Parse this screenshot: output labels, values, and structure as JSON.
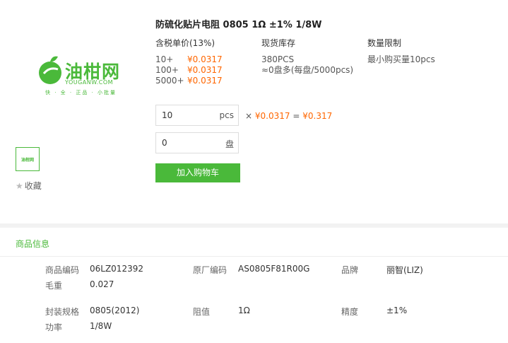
{
  "logo": {
    "brand": "油柑网",
    "domain": "YOUGANW.COM",
    "slogan": "快 · 全 · 正品 · 小批量",
    "thumb_text": "油柑网"
  },
  "favorite_label": "收藏",
  "product": {
    "title": "防硫化贴片电阻 0805 1Ω ±1% 1/8W"
  },
  "price_col": {
    "header": "含税单价(13%)",
    "tiers": [
      {
        "qty": "10+",
        "price": "¥0.0317"
      },
      {
        "qty": "100+",
        "price": "¥0.0317"
      },
      {
        "qty": "5000+",
        "price": "¥0.0317"
      }
    ]
  },
  "stock_col": {
    "header": "现货库存",
    "lines": [
      "380PCS",
      "≈0盘多(每盘/5000pcs)"
    ]
  },
  "limit_col": {
    "header": "数量限制",
    "lines": [
      "最小购买量10pcs"
    ]
  },
  "order": {
    "pcs_value": "10",
    "pcs_unit": "pcs",
    "reel_value": "0",
    "reel_unit": "盘",
    "times": "×",
    "unit_price": "¥0.0317",
    "equals": "=",
    "total": "¥0.317",
    "cart_button": "加入购物车"
  },
  "info": {
    "title": "商品信息",
    "rows": [
      {
        "l1": "商品编码",
        "v1": "06LZ012392",
        "l2": "原厂编码",
        "v2": "AS0805F81R00G",
        "l3": "品牌",
        "v3": "丽智(LIZ)"
      },
      {
        "l1": "毛重",
        "v1": "0.027"
      },
      {
        "l1": "封装规格",
        "v1": "0805(2012)",
        "l2": "阻值",
        "v2": "1Ω",
        "l3": "精度",
        "v3": "±1%"
      },
      {
        "l1": "功率",
        "v1": "1/8W"
      }
    ]
  },
  "colors": {
    "green": "#4ab93a",
    "orange": "#ff6600"
  }
}
